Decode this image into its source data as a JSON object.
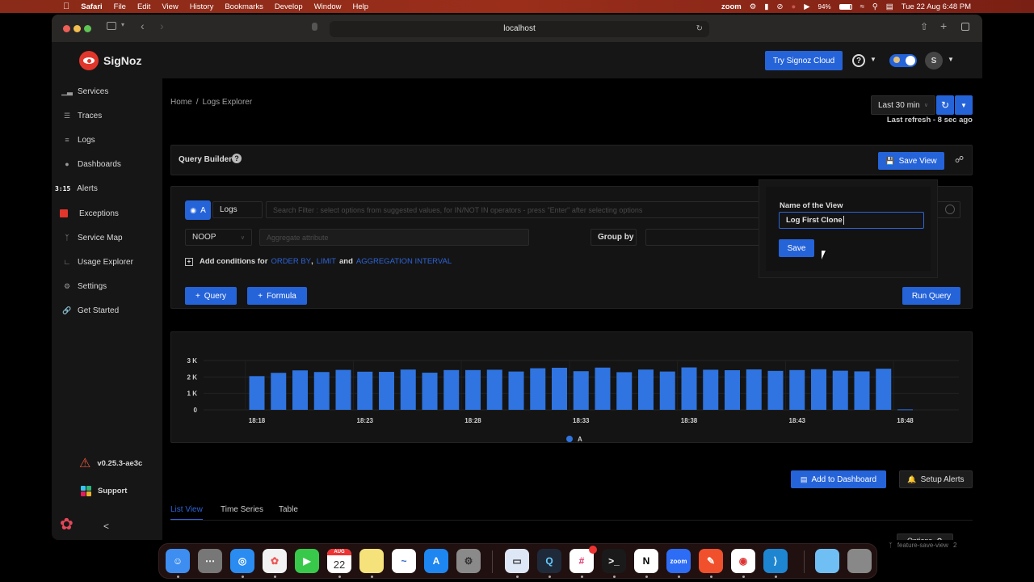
{
  "menubar": {
    "apple": "",
    "items": [
      "Safari",
      "File",
      "Edit",
      "View",
      "History",
      "Bookmarks",
      "Develop",
      "Window",
      "Help"
    ],
    "status": {
      "zoom": "zoom",
      "battery": "94%",
      "datetime": "Tue 22 Aug  6:48 PM"
    }
  },
  "browser": {
    "url": "localhost"
  },
  "app": {
    "brand": "SigNoz",
    "try_cloud": "Try Signoz Cloud",
    "avatar_initial": "S",
    "sidebar": {
      "items": [
        {
          "label": "Services",
          "icon": "bar-chart-icon"
        },
        {
          "label": "Traces",
          "icon": "menu-icon"
        },
        {
          "label": "Logs",
          "icon": "logs-icon"
        },
        {
          "label": "Dashboards",
          "icon": "dashboard-icon"
        },
        {
          "label": "Alerts",
          "icon": "alert-icon",
          "prefix": "3:15"
        },
        {
          "label": "Exceptions",
          "icon": "exceptions-icon"
        },
        {
          "label": "Service Map",
          "icon": "service-map-icon"
        },
        {
          "label": "Usage Explorer",
          "icon": "line-chart-icon"
        },
        {
          "label": "Settings",
          "icon": "settings-icon"
        },
        {
          "label": "Get Started",
          "icon": "link-icon"
        }
      ],
      "version": "v0.25.3-ae3c",
      "support": "Support",
      "collapse": "<"
    },
    "breadcrumb": {
      "home": "Home",
      "separator": "/",
      "current": "Logs Explorer"
    },
    "time_range": "Last 30 min",
    "last_refresh": "Last refresh - 8 sec ago",
    "query_builder": {
      "title": "Query Builder",
      "save_view": "Save View",
      "query_label": "A",
      "data_source": "Logs",
      "search_placeholder": "Search Filter : select options from suggested values, for IN/NOT IN operators - press \"Enter\" after selecting options",
      "aggregate_op": "NOOP",
      "aggregate_placeholder": "Aggregate attribute",
      "group_by": "Group by",
      "add_conditions_prefix": "Add conditions for",
      "order_by": "ORDER BY",
      "comma": ",",
      "limit": "LIMIT",
      "and": "and",
      "aggregation_interval": "AGGREGATION INTERVAL",
      "add_query": "Query",
      "add_formula": "Formula",
      "run_query": "Run Query"
    },
    "save_view_popover": {
      "label": "Name of the View",
      "value": "Log First Clone",
      "save": "Save"
    },
    "actions": {
      "add_to_dashboard": "Add to Dashboard",
      "setup_alerts": "Setup Alerts",
      "options": "Options"
    },
    "tabs": [
      {
        "label": "List View",
        "active": true
      },
      {
        "label": "Time Series",
        "active": false
      },
      {
        "label": "Table",
        "active": false
      }
    ]
  },
  "chart_data": {
    "type": "bar",
    "title": "",
    "xlabel": "",
    "ylabel": "",
    "ylim": [
      0,
      3000
    ],
    "yticks": [
      "0",
      "1 K",
      "2 K",
      "3 K"
    ],
    "xticks": [
      "18:18",
      "18:23",
      "18:28",
      "18:33",
      "18:38",
      "18:43",
      "18:48"
    ],
    "categories": [
      "18:18",
      "18:19",
      "18:20",
      "18:21",
      "18:22",
      "18:23",
      "18:24",
      "18:25",
      "18:26",
      "18:27",
      "18:28",
      "18:29",
      "18:30",
      "18:31",
      "18:32",
      "18:33",
      "18:34",
      "18:35",
      "18:36",
      "18:37",
      "18:38",
      "18:39",
      "18:40",
      "18:41",
      "18:42",
      "18:43",
      "18:44",
      "18:45",
      "18:46",
      "18:47",
      "18:48"
    ],
    "series": [
      {
        "name": "A",
        "color": "#2f74e0",
        "values": [
          2050,
          2250,
          2400,
          2300,
          2430,
          2320,
          2310,
          2450,
          2260,
          2420,
          2420,
          2440,
          2330,
          2530,
          2560,
          2350,
          2570,
          2290,
          2450,
          2330,
          2580,
          2440,
          2410,
          2460,
          2370,
          2420,
          2470,
          2380,
          2340,
          2500,
          30
        ]
      }
    ],
    "legend": [
      "A"
    ],
    "legend_position": "bottom-center",
    "grid": true
  },
  "dock": {
    "apps": [
      "Finder",
      "Launchpad",
      "Safari",
      "Photos",
      "FaceTime",
      "Calendar",
      "Notes",
      "Freeform",
      "App Store",
      "System Settings",
      "Preview",
      "QuickTime",
      "Slack",
      "Terminal",
      "Notion",
      "Zoom",
      "Postman",
      "Chrome",
      "VS Code",
      "Folder",
      "Trash"
    ],
    "calendar_month": "AUG",
    "calendar_day": "22",
    "slack_badge": "•"
  },
  "terminal_hint": {
    "branch": "feature-save-view",
    "count": "2"
  }
}
